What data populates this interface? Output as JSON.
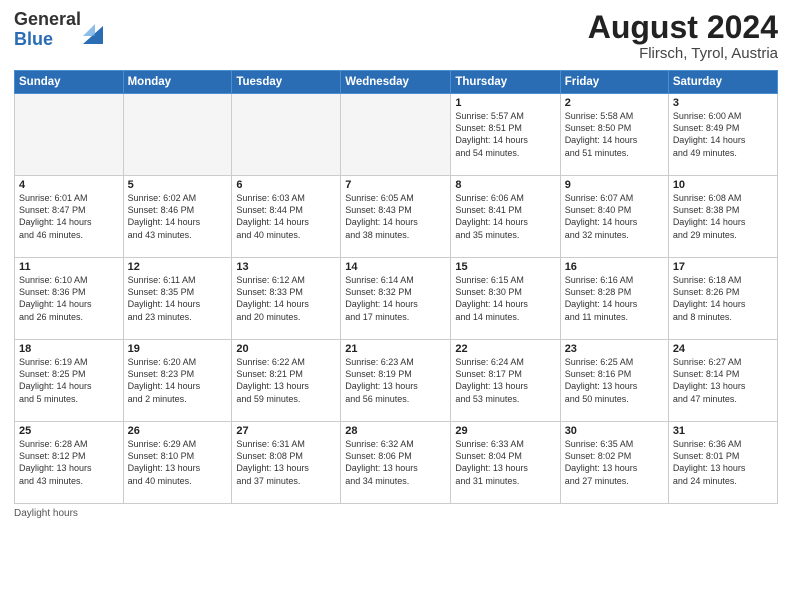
{
  "header": {
    "logo_general": "General",
    "logo_blue": "Blue",
    "month_year": "August 2024",
    "location": "Flirsch, Tyrol, Austria"
  },
  "days_of_week": [
    "Sunday",
    "Monday",
    "Tuesday",
    "Wednesday",
    "Thursday",
    "Friday",
    "Saturday"
  ],
  "footer": {
    "daylight_label": "Daylight hours"
  },
  "weeks": [
    [
      {
        "day": "",
        "info": ""
      },
      {
        "day": "",
        "info": ""
      },
      {
        "day": "",
        "info": ""
      },
      {
        "day": "",
        "info": ""
      },
      {
        "day": "1",
        "info": "Sunrise: 5:57 AM\nSunset: 8:51 PM\nDaylight: 14 hours\nand 54 minutes."
      },
      {
        "day": "2",
        "info": "Sunrise: 5:58 AM\nSunset: 8:50 PM\nDaylight: 14 hours\nand 51 minutes."
      },
      {
        "day": "3",
        "info": "Sunrise: 6:00 AM\nSunset: 8:49 PM\nDaylight: 14 hours\nand 49 minutes."
      }
    ],
    [
      {
        "day": "4",
        "info": "Sunrise: 6:01 AM\nSunset: 8:47 PM\nDaylight: 14 hours\nand 46 minutes."
      },
      {
        "day": "5",
        "info": "Sunrise: 6:02 AM\nSunset: 8:46 PM\nDaylight: 14 hours\nand 43 minutes."
      },
      {
        "day": "6",
        "info": "Sunrise: 6:03 AM\nSunset: 8:44 PM\nDaylight: 14 hours\nand 40 minutes."
      },
      {
        "day": "7",
        "info": "Sunrise: 6:05 AM\nSunset: 8:43 PM\nDaylight: 14 hours\nand 38 minutes."
      },
      {
        "day": "8",
        "info": "Sunrise: 6:06 AM\nSunset: 8:41 PM\nDaylight: 14 hours\nand 35 minutes."
      },
      {
        "day": "9",
        "info": "Sunrise: 6:07 AM\nSunset: 8:40 PM\nDaylight: 14 hours\nand 32 minutes."
      },
      {
        "day": "10",
        "info": "Sunrise: 6:08 AM\nSunset: 8:38 PM\nDaylight: 14 hours\nand 29 minutes."
      }
    ],
    [
      {
        "day": "11",
        "info": "Sunrise: 6:10 AM\nSunset: 8:36 PM\nDaylight: 14 hours\nand 26 minutes."
      },
      {
        "day": "12",
        "info": "Sunrise: 6:11 AM\nSunset: 8:35 PM\nDaylight: 14 hours\nand 23 minutes."
      },
      {
        "day": "13",
        "info": "Sunrise: 6:12 AM\nSunset: 8:33 PM\nDaylight: 14 hours\nand 20 minutes."
      },
      {
        "day": "14",
        "info": "Sunrise: 6:14 AM\nSunset: 8:32 PM\nDaylight: 14 hours\nand 17 minutes."
      },
      {
        "day": "15",
        "info": "Sunrise: 6:15 AM\nSunset: 8:30 PM\nDaylight: 14 hours\nand 14 minutes."
      },
      {
        "day": "16",
        "info": "Sunrise: 6:16 AM\nSunset: 8:28 PM\nDaylight: 14 hours\nand 11 minutes."
      },
      {
        "day": "17",
        "info": "Sunrise: 6:18 AM\nSunset: 8:26 PM\nDaylight: 14 hours\nand 8 minutes."
      }
    ],
    [
      {
        "day": "18",
        "info": "Sunrise: 6:19 AM\nSunset: 8:25 PM\nDaylight: 14 hours\nand 5 minutes."
      },
      {
        "day": "19",
        "info": "Sunrise: 6:20 AM\nSunset: 8:23 PM\nDaylight: 14 hours\nand 2 minutes."
      },
      {
        "day": "20",
        "info": "Sunrise: 6:22 AM\nSunset: 8:21 PM\nDaylight: 13 hours\nand 59 minutes."
      },
      {
        "day": "21",
        "info": "Sunrise: 6:23 AM\nSunset: 8:19 PM\nDaylight: 13 hours\nand 56 minutes."
      },
      {
        "day": "22",
        "info": "Sunrise: 6:24 AM\nSunset: 8:17 PM\nDaylight: 13 hours\nand 53 minutes."
      },
      {
        "day": "23",
        "info": "Sunrise: 6:25 AM\nSunset: 8:16 PM\nDaylight: 13 hours\nand 50 minutes."
      },
      {
        "day": "24",
        "info": "Sunrise: 6:27 AM\nSunset: 8:14 PM\nDaylight: 13 hours\nand 47 minutes."
      }
    ],
    [
      {
        "day": "25",
        "info": "Sunrise: 6:28 AM\nSunset: 8:12 PM\nDaylight: 13 hours\nand 43 minutes."
      },
      {
        "day": "26",
        "info": "Sunrise: 6:29 AM\nSunset: 8:10 PM\nDaylight: 13 hours\nand 40 minutes."
      },
      {
        "day": "27",
        "info": "Sunrise: 6:31 AM\nSunset: 8:08 PM\nDaylight: 13 hours\nand 37 minutes."
      },
      {
        "day": "28",
        "info": "Sunrise: 6:32 AM\nSunset: 8:06 PM\nDaylight: 13 hours\nand 34 minutes."
      },
      {
        "day": "29",
        "info": "Sunrise: 6:33 AM\nSunset: 8:04 PM\nDaylight: 13 hours\nand 31 minutes."
      },
      {
        "day": "30",
        "info": "Sunrise: 6:35 AM\nSunset: 8:02 PM\nDaylight: 13 hours\nand 27 minutes."
      },
      {
        "day": "31",
        "info": "Sunrise: 6:36 AM\nSunset: 8:01 PM\nDaylight: 13 hours\nand 24 minutes."
      }
    ]
  ]
}
